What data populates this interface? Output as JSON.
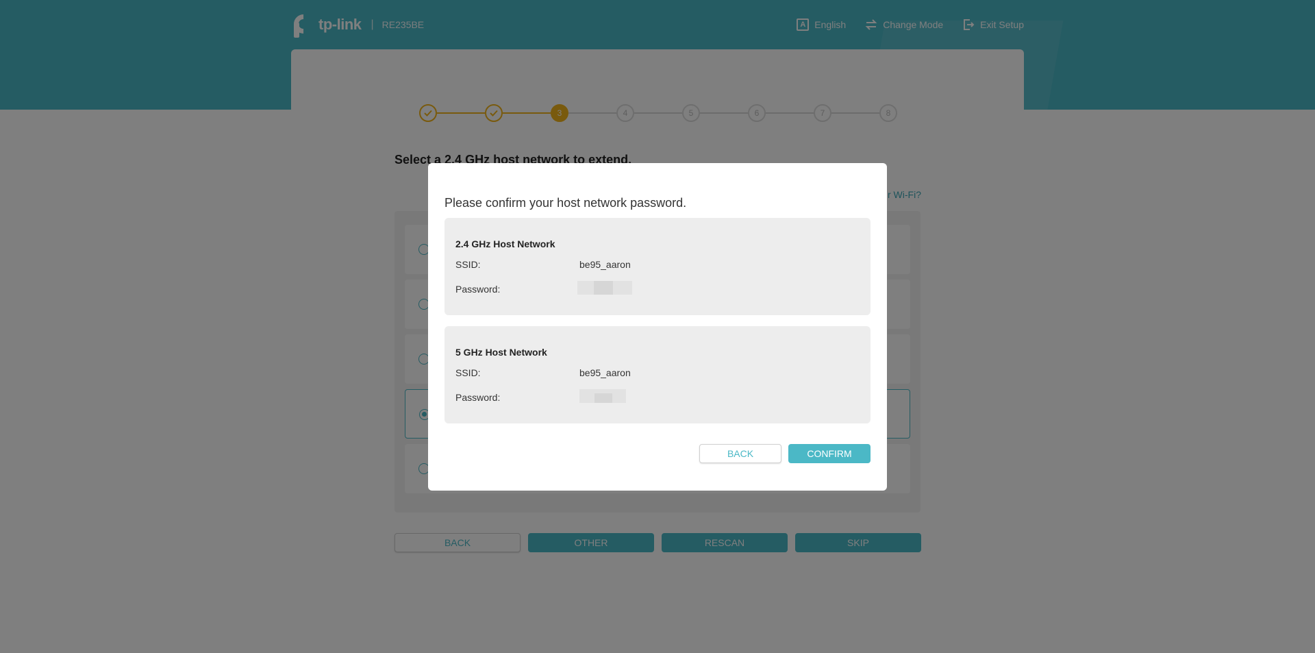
{
  "header": {
    "brand": "tp-link",
    "separator": "|",
    "model": "RE235BE",
    "actions": [
      {
        "label": "English",
        "icon": "language-icon"
      },
      {
        "label": "Change Mode",
        "icon": "swap-icon"
      },
      {
        "label": "Exit Setup",
        "icon": "exit-icon"
      }
    ]
  },
  "stepper": {
    "steps": [
      "1",
      "2",
      "3",
      "4",
      "5",
      "6",
      "7",
      "8"
    ],
    "current": 3
  },
  "page": {
    "heading": "Select a 2.4 GHz host network to extend.",
    "help_link": "r Wi-Fi?"
  },
  "buttons": {
    "back": "BACK",
    "other": "OTHER",
    "rescan": "RESCAN",
    "skip": "SKIP"
  },
  "modal": {
    "title": "Please confirm your host network password.",
    "networks": [
      {
        "title": "2.4 GHz Host Network",
        "ssid_label": "SSID:",
        "ssid": "be95_aaron",
        "password_label": "Password:"
      },
      {
        "title": "5 GHz Host Network",
        "ssid_label": "SSID:",
        "ssid": "be95_aaron",
        "password_label": "Password:"
      }
    ],
    "back": "BACK",
    "confirm": "CONFIRM"
  },
  "colors": {
    "accent": "#4bb8c6",
    "step_done": "#f3b51b"
  }
}
